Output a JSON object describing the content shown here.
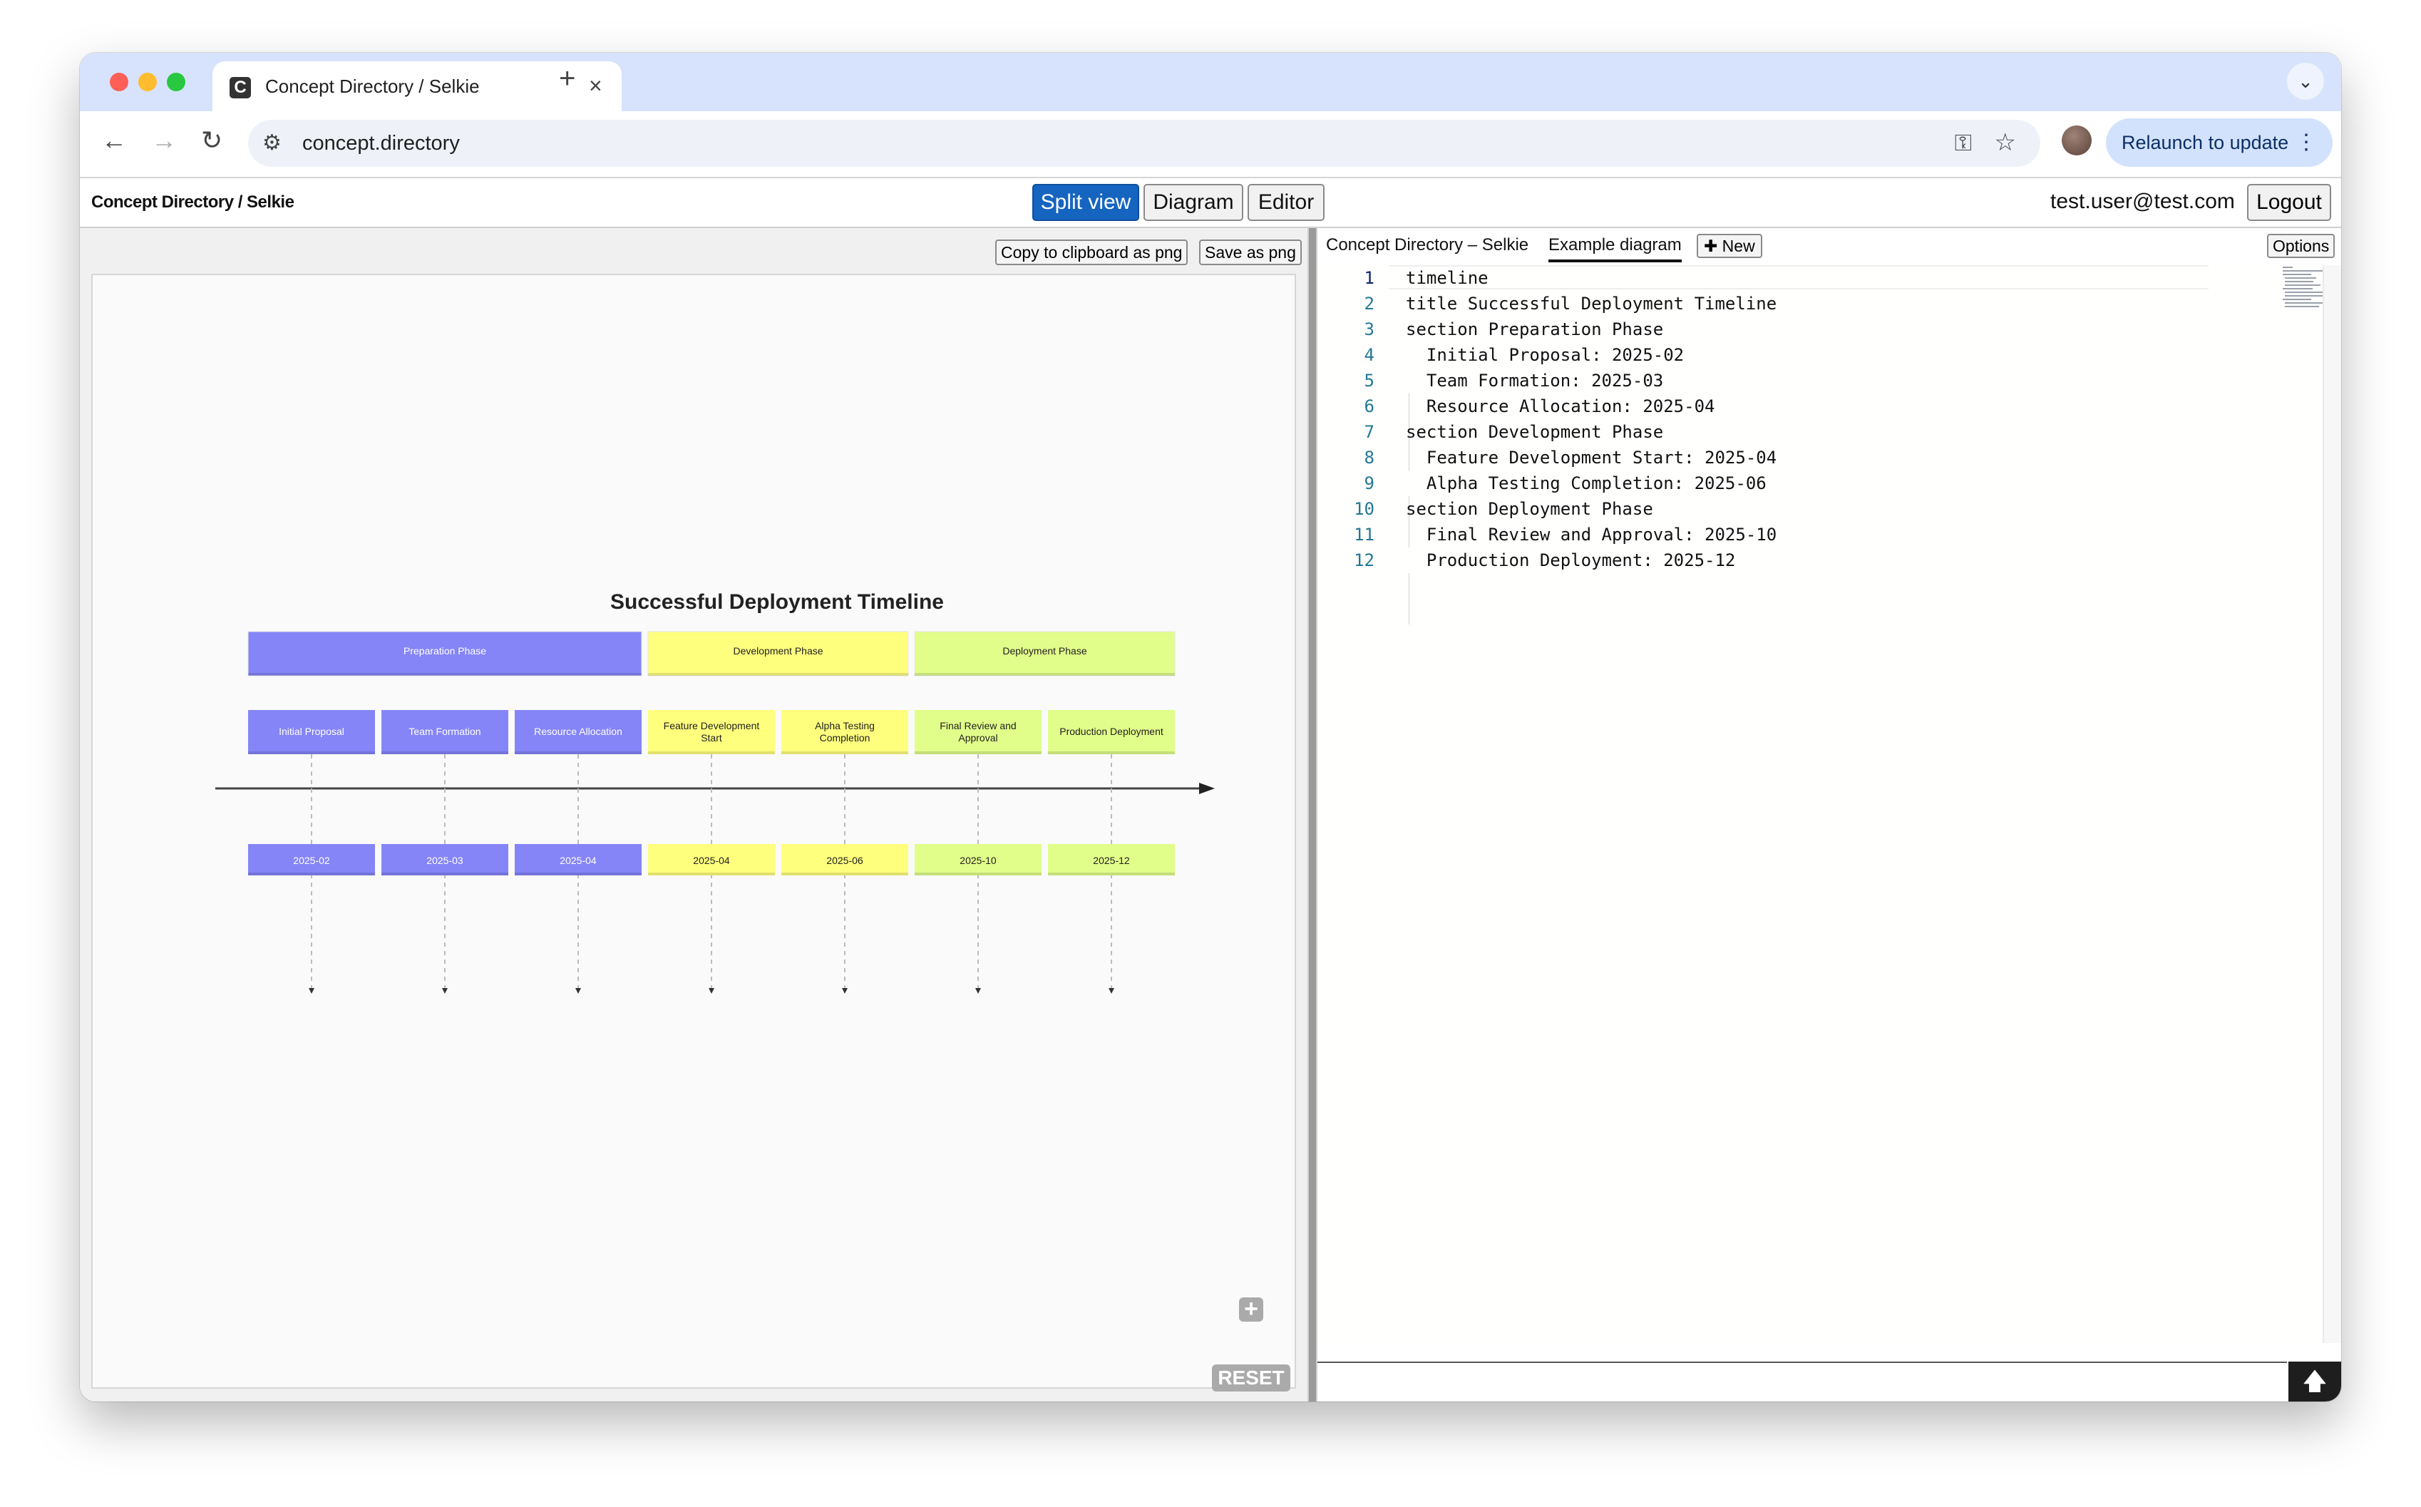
{
  "browser": {
    "tab_title": "Concept Directory / Selkie",
    "tab_favicon": "C",
    "new_tab": "+",
    "url": "concept.directory",
    "relaunch": "Relaunch to update"
  },
  "app": {
    "brand": "Concept Directory / Selkie",
    "views": [
      "Split view",
      "Diagram",
      "Editor"
    ],
    "active_view": "Split view",
    "user_email": "test.user@test.com",
    "logout": "Logout"
  },
  "diagram_pane": {
    "copy_png": "Copy to clipboard as png",
    "save_png": "Save as png",
    "zoom_in": "+",
    "reset": "RESET",
    "zoom_out": "−"
  },
  "timeline": {
    "title": "Successful Deployment Timeline",
    "sections": [
      {
        "name": "Preparation Phase",
        "color": "#8585f7",
        "events": [
          {
            "label": "Initial Proposal",
            "date": "2025-02"
          },
          {
            "label": "Team Formation",
            "date": "2025-03"
          },
          {
            "label": "Resource Allocation",
            "date": "2025-04"
          }
        ]
      },
      {
        "name": "Development Phase",
        "color": "#ffff7e",
        "events": [
          {
            "label": "Feature Development Start",
            "date": "2025-04"
          },
          {
            "label": "Alpha Testing Completion",
            "date": "2025-06"
          }
        ]
      },
      {
        "name": "Deployment Phase",
        "color": "#e1fd8a",
        "events": [
          {
            "label": "Final Review and Approval",
            "date": "2025-10"
          },
          {
            "label": "Production Deployment",
            "date": "2025-12"
          }
        ]
      }
    ]
  },
  "editor_pane": {
    "tabs": [
      "Concept Directory – Selkie",
      "Example diagram"
    ],
    "selected_tab": "Example diagram",
    "new_button": "✚ New",
    "options": "Options",
    "code_lines": [
      "timeline",
      "title Successful Deployment Timeline",
      "section Preparation Phase",
      "  Initial Proposal: 2025-02",
      "  Team Formation: 2025-03",
      "  Resource Allocation: 2025-04",
      "section Development Phase",
      "  Feature Development Start: 2025-04",
      "  Alpha Testing Completion: 2025-06",
      "section Deployment Phase",
      "  Final Review and Approval: 2025-10",
      "  Production Deployment: 2025-12"
    ],
    "send_icon": "🡅"
  }
}
